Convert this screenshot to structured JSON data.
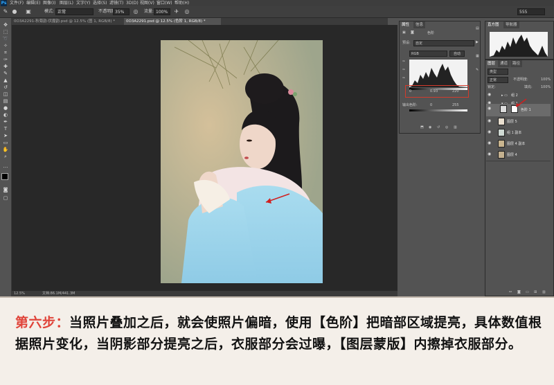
{
  "app": {
    "logo": "Ps"
  },
  "menubar": {
    "items": [
      "文件(F)",
      "编辑(E)",
      "图像(I)",
      "图层(L)",
      "文字(Y)",
      "选择(S)",
      "滤镜(T)",
      "3D(D)",
      "视图(V)",
      "窗口(W)",
      "帮助(H)"
    ]
  },
  "options": {
    "mode_label": "模式:",
    "mode_value": "正常",
    "opacity_label": "不透明度:",
    "opacity_value": "35%",
    "flow_label": "流量:",
    "flow_value": "100%",
    "brush_size": "555"
  },
  "doc_tabs": [
    {
      "label": "0O3A2291-秋菊韵-伏魔韵.psd @ 12.5% (图 1, RGB/8) *",
      "active": false
    },
    {
      "label": "0O3A2291.psd @ 12.5% (色阶 1, RGB/8) *",
      "active": true
    }
  ],
  "status": {
    "zoom": "12.5%",
    "doc_size": "文档:86.1M/441.3M"
  },
  "properties": {
    "tabs": [
      "属性",
      "信息"
    ],
    "title": "色阶",
    "preset_label": "预设:",
    "preset_value": "自定",
    "channel": "RGB",
    "auto": "自动",
    "input_values": [
      "0",
      "0.93",
      "220"
    ],
    "output_label": "输出色阶:",
    "output_values": [
      "0",
      "255"
    ]
  },
  "histogram_panel": {
    "tabs": [
      "直方图",
      "导航器"
    ]
  },
  "layers_panel": {
    "tabs": [
      "图层",
      "通道",
      "路径"
    ],
    "kind": "类型",
    "blend": "正常",
    "opacity_label": "不透明度:",
    "opacity": "100%",
    "lock_label": "锁定:",
    "fill_label": "填充:",
    "fill": "100%",
    "layers": [
      {
        "name": "组 2",
        "type": "group",
        "selected": false
      },
      {
        "name": "组 1",
        "type": "group",
        "selected": false
      },
      {
        "name": "色阶 1",
        "type": "adjustment",
        "selected": true
      },
      {
        "name": "图层 5",
        "type": "pixel",
        "selected": false
      },
      {
        "name": "组 1 副本",
        "type": "pixel",
        "selected": false
      },
      {
        "name": "图层 4 副本",
        "type": "pixel",
        "selected": false
      },
      {
        "name": "图层 4",
        "type": "pixel",
        "selected": false
      }
    ]
  },
  "caption": {
    "step": "第六步：",
    "text": "当照片叠加之后，就会使照片偏暗，使用【色阶】把暗部区域提亮，具体数值根据照片变化，当阴影部分提亮之后，衣服部分会过曝，【图层蒙版】内擦掉衣服部分。"
  },
  "colors": {
    "accent_red": "#e0443a",
    "box_outline": "#d33b2c"
  }
}
